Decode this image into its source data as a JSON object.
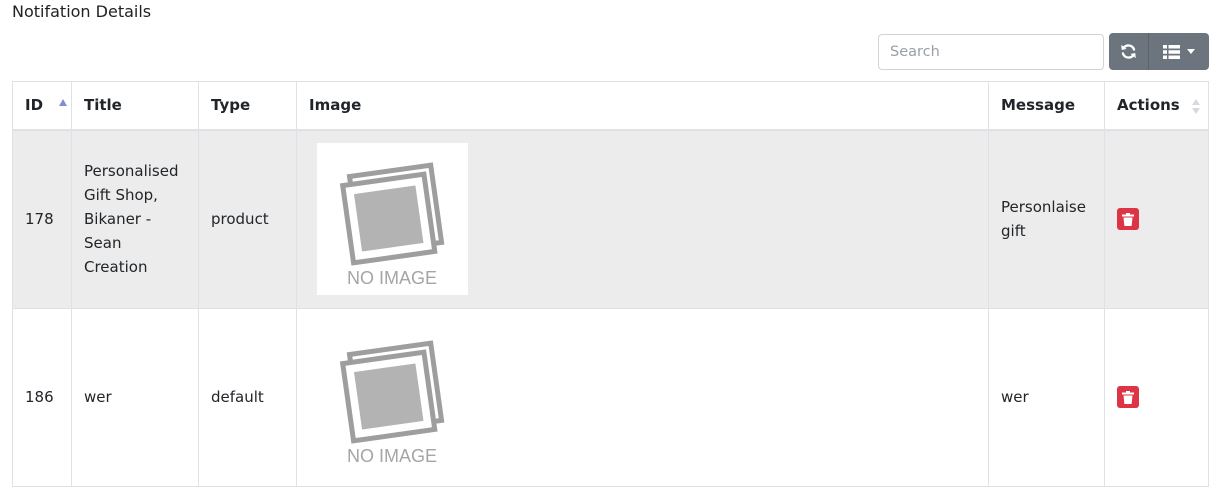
{
  "page": {
    "title": "Notifation Details"
  },
  "toolbar": {
    "search_placeholder": "Search",
    "refresh_icon": "refresh-icon",
    "columns_icon": "list-columns-icon"
  },
  "table": {
    "headers": {
      "id": "ID",
      "title": "Title",
      "type": "Type",
      "image": "Image",
      "message": "Message",
      "actions": "Actions"
    },
    "rows": [
      {
        "id": "178",
        "title": "Personalised Gift Shop, Bikaner - Sean Creation",
        "type": "product",
        "image_text": "NO IMAGE",
        "message": "Personlaise gift"
      },
      {
        "id": "186",
        "title": "wer",
        "type": "default",
        "image_text": "NO IMAGE",
        "message": "wer"
      }
    ]
  },
  "colors": {
    "danger": "#dc3545",
    "secondary": "#6c757d",
    "row_striped": "#ececec"
  }
}
